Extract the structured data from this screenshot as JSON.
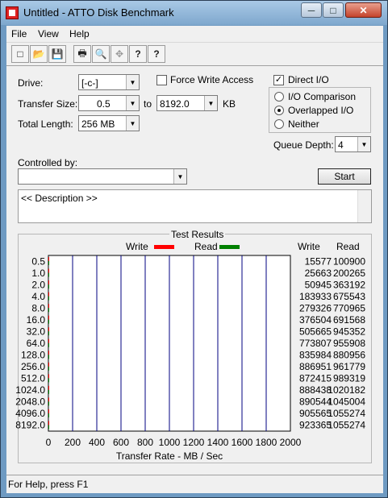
{
  "window": {
    "title": "Untitled - ATTO Disk Benchmark",
    "minimize": "─",
    "maximize": "□",
    "close": "✕"
  },
  "menu": {
    "file": "File",
    "view": "View",
    "help": "Help"
  },
  "toolbar": {
    "icons": [
      "new-document-icon",
      "open-folder-icon",
      "save-icon",
      "print-icon",
      "print-preview-icon",
      "move-icon",
      "help-icon",
      "context-help-icon"
    ],
    "glyphs": [
      "□",
      "📂",
      "💾",
      "🖶",
      "🔍",
      "✥",
      "?",
      "?"
    ]
  },
  "settings": {
    "drive_label": "Drive:",
    "drive_value": "[-c-]",
    "transfer_size_label": "Transfer Size:",
    "transfer_from": "0.5",
    "to_label": "to",
    "transfer_to": "8192.0",
    "kb_label": "KB",
    "total_length_label": "Total Length:",
    "total_length_value": "256 MB",
    "force_write_label": "Force Write Access",
    "force_write_checked": false,
    "direct_io_label": "Direct I/O",
    "direct_io_checked": true,
    "io_comparison_label": "I/O Comparison",
    "overlapped_io_label": "Overlapped I/O",
    "neither_label": "Neither",
    "selected_mode": "Overlapped I/O",
    "queue_depth_label": "Queue Depth:",
    "queue_depth_value": "4",
    "controlled_by_label": "Controlled by:",
    "controlled_by_value": "",
    "start_label": "Start",
    "description_text": "<< Description >>"
  },
  "results": {
    "title": "Test Results",
    "write_col": "Write",
    "read_col": "Read"
  },
  "chart_data": {
    "type": "bar",
    "orientation": "horizontal",
    "categories": [
      "0.5",
      "1.0",
      "2.0",
      "4.0",
      "8.0",
      "16.0",
      "32.0",
      "64.0",
      "128.0",
      "256.0",
      "512.0",
      "1024.0",
      "2048.0",
      "4096.0",
      "8192.0"
    ],
    "series": [
      {
        "name": "Write",
        "color": "#ff0000",
        "values": [
          15577,
          25663,
          50945,
          183933,
          279326,
          376504,
          505665,
          773807,
          835984,
          886951,
          872415,
          888438,
          890544,
          905565,
          923365
        ]
      },
      {
        "name": "Read",
        "color": "#008000",
        "values": [
          100900,
          200265,
          363192,
          675543,
          770965,
          691568,
          945352,
          955908,
          880956,
          961779,
          989319,
          1020182,
          1045004,
          1055274,
          1055274
        ]
      }
    ],
    "xlabel": "Transfer Rate - MB / Sec",
    "xlim": [
      0,
      2000
    ],
    "xticks": [
      "0",
      "200",
      "400",
      "600",
      "800",
      "1000",
      "1200",
      "1400",
      "1600",
      "1800",
      "2000"
    ],
    "legend": "top",
    "grid": true
  },
  "status": {
    "text": "For Help, press F1"
  }
}
